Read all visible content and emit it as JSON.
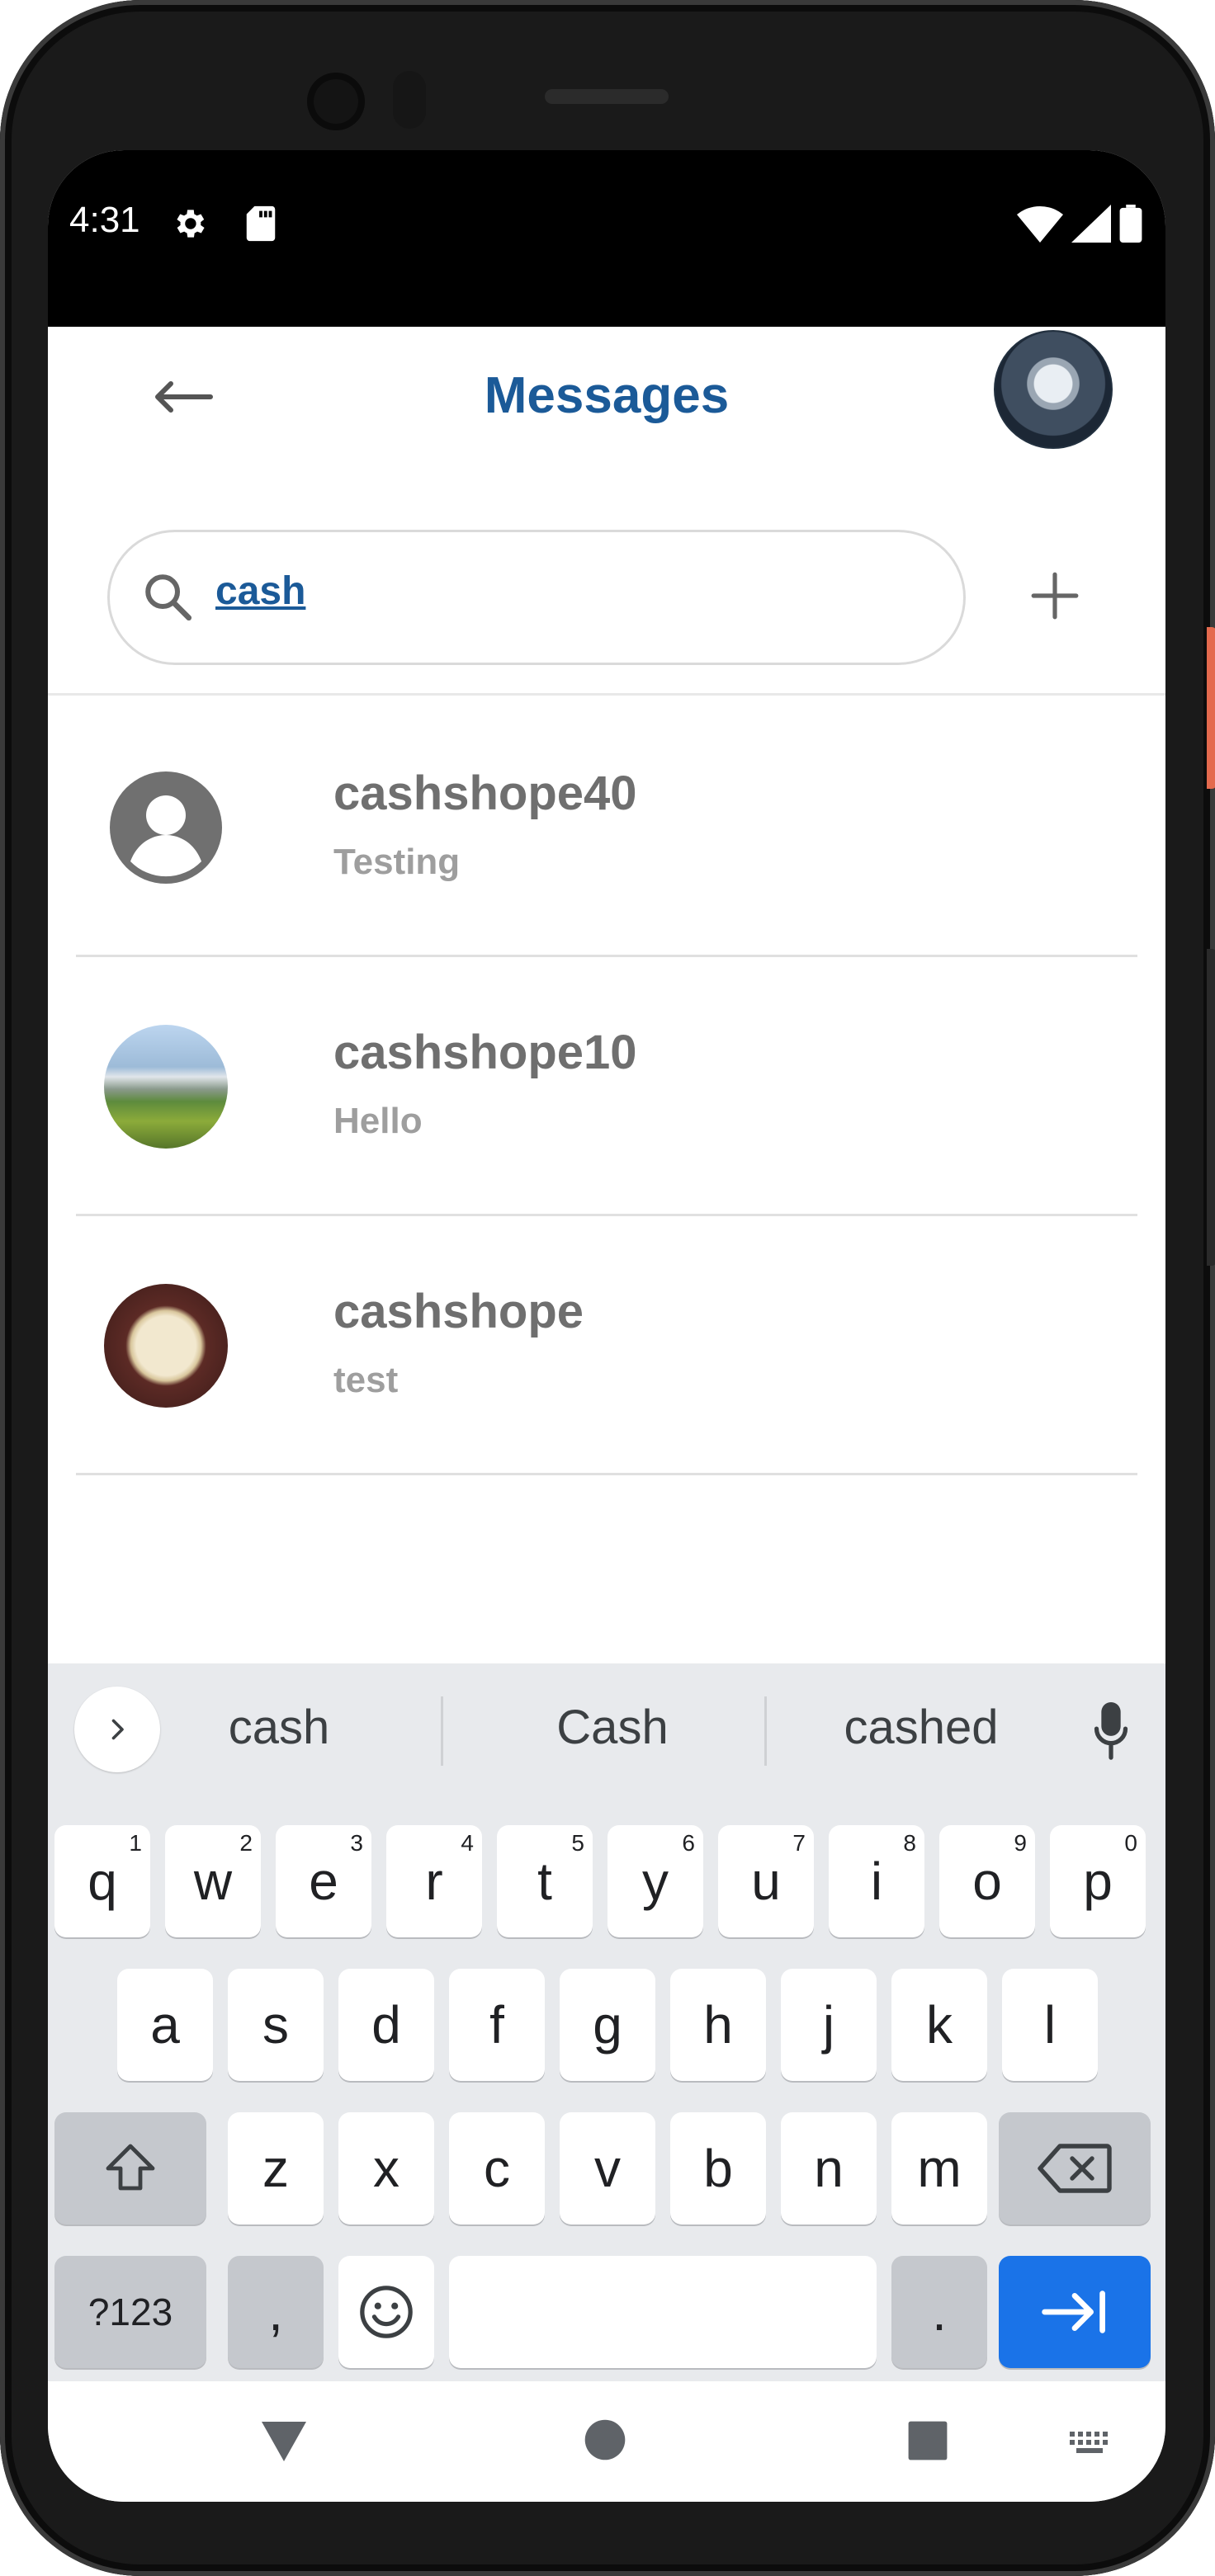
{
  "status_bar": {
    "time": "4:31"
  },
  "header": {
    "title": "Messages",
    "back_icon": "arrow-left-icon",
    "avatar_icon": "profile-avatar"
  },
  "search": {
    "value": "cash",
    "placeholder": ""
  },
  "conversations": [
    {
      "name": "cashshope40",
      "preview": "Testing",
      "avatar": "default-person-icon"
    },
    {
      "name": "cashshope10",
      "preview": "Hello",
      "avatar": "campus-photo"
    },
    {
      "name": "cashshope",
      "preview": "test",
      "avatar": "open-book-photo"
    }
  ],
  "keyboard": {
    "suggestions": [
      "cash",
      "Cash",
      "cashed"
    ],
    "row1": [
      "q",
      "w",
      "e",
      "r",
      "t",
      "y",
      "u",
      "i",
      "o",
      "p"
    ],
    "row1_hints": [
      "1",
      "2",
      "3",
      "4",
      "5",
      "6",
      "7",
      "8",
      "9",
      "0"
    ],
    "row2": [
      "a",
      "s",
      "d",
      "f",
      "g",
      "h",
      "j",
      "k",
      "l"
    ],
    "row3": [
      "z",
      "x",
      "c",
      "v",
      "b",
      "n",
      "m"
    ],
    "symbols_label": "?123",
    "comma_label": ",",
    "period_label": "."
  },
  "colors": {
    "title": "#1b5a98",
    "accent_key": "#1a73e8"
  }
}
